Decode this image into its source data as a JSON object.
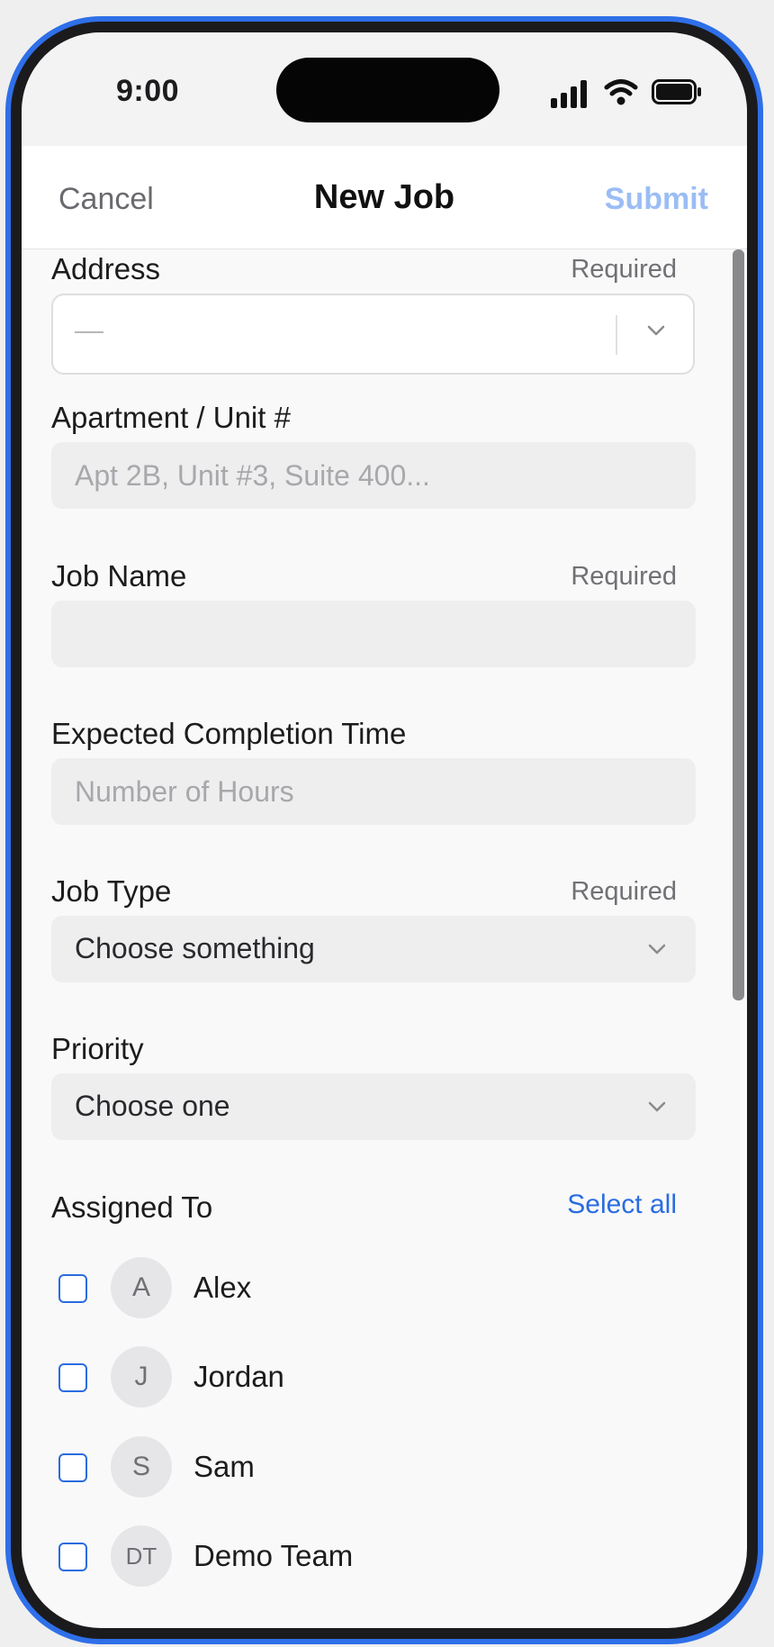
{
  "status_bar": {
    "time": "9:00"
  },
  "nav": {
    "cancel_label": "Cancel",
    "title": "New Job",
    "submit_label": "Submit"
  },
  "form": {
    "required_label": "Required",
    "address": {
      "label": "Address",
      "value": "—"
    },
    "apartment": {
      "label": "Apartment / Unit #",
      "placeholder": "Apt 2B, Unit #3, Suite 400..."
    },
    "job_name": {
      "label": "Job Name",
      "value": ""
    },
    "completion": {
      "label": "Expected Completion Time",
      "placeholder": "Number of Hours"
    },
    "job_type": {
      "label": "Job Type",
      "value": "Choose something"
    },
    "priority": {
      "label": "Priority",
      "value": "Choose one"
    },
    "assigned": {
      "label": "Assigned To",
      "select_all_label": "Select all",
      "people": [
        {
          "initials": "A",
          "name": "Alex",
          "checked": false
        },
        {
          "initials": "J",
          "name": "Jordan",
          "checked": false
        },
        {
          "initials": "S",
          "name": "Sam",
          "checked": false
        },
        {
          "initials": "DT",
          "name": "Demo Team",
          "checked": false
        }
      ]
    }
  },
  "colors": {
    "frame": "#2f6fe8",
    "accent": "#2a6ce0",
    "submit_disabled": "#9bbdf5",
    "field_bg": "#eeeeef",
    "screen_bg": "#f9f9f9"
  },
  "icons": [
    "signal-icon",
    "wifi-icon",
    "battery-icon",
    "chevron-down-icon"
  ]
}
